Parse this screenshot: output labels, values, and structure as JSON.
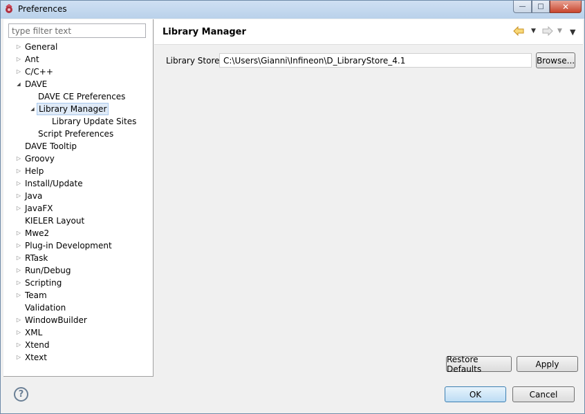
{
  "window": {
    "title": "Preferences",
    "controls": {
      "minimize": "—",
      "maximize": "□",
      "close": "✕"
    }
  },
  "filter": {
    "placeholder": "type filter text",
    "value": ""
  },
  "tree": [
    {
      "label": "General",
      "expander": "collapsed",
      "indent": 0
    },
    {
      "label": "Ant",
      "expander": "collapsed",
      "indent": 0
    },
    {
      "label": "C/C++",
      "expander": "collapsed",
      "indent": 0
    },
    {
      "label": "DAVE",
      "expander": "expanded",
      "indent": 0
    },
    {
      "label": "DAVE CE Preferences",
      "expander": "none",
      "indent": 1
    },
    {
      "label": "Library Manager",
      "expander": "expanded",
      "indent": 1,
      "selected": true
    },
    {
      "label": "Library Update Sites",
      "expander": "none",
      "indent": 2
    },
    {
      "label": "Script Preferences",
      "expander": "none",
      "indent": 1
    },
    {
      "label": "DAVE Tooltip",
      "expander": "none",
      "indent": 0
    },
    {
      "label": "Groovy",
      "expander": "collapsed",
      "indent": 0
    },
    {
      "label": "Help",
      "expander": "collapsed",
      "indent": 0
    },
    {
      "label": "Install/Update",
      "expander": "collapsed",
      "indent": 0
    },
    {
      "label": "Java",
      "expander": "collapsed",
      "indent": 0
    },
    {
      "label": "JavaFX",
      "expander": "collapsed",
      "indent": 0
    },
    {
      "label": "KIELER Layout",
      "expander": "none",
      "indent": 0
    },
    {
      "label": "Mwe2",
      "expander": "collapsed",
      "indent": 0
    },
    {
      "label": "Plug-in Development",
      "expander": "collapsed",
      "indent": 0
    },
    {
      "label": "RTask",
      "expander": "collapsed",
      "indent": 0
    },
    {
      "label": "Run/Debug",
      "expander": "collapsed",
      "indent": 0
    },
    {
      "label": "Scripting",
      "expander": "collapsed",
      "indent": 0
    },
    {
      "label": "Team",
      "expander": "collapsed",
      "indent": 0
    },
    {
      "label": "Validation",
      "expander": "none",
      "indent": 0
    },
    {
      "label": "WindowBuilder",
      "expander": "collapsed",
      "indent": 0
    },
    {
      "label": "XML",
      "expander": "collapsed",
      "indent": 0
    },
    {
      "label": "Xtend",
      "expander": "collapsed",
      "indent": 0
    },
    {
      "label": "Xtext",
      "expander": "collapsed",
      "indent": 0
    }
  ],
  "page": {
    "title": "Library Manager",
    "library_store_label": "Library Store :",
    "library_store_value": "C:\\Users\\Gianni\\Infineon\\D_LibraryStore_4.1",
    "browse_label": "Browse...",
    "restore_defaults_label": "Restore Defaults",
    "apply_label": "Apply"
  },
  "footer": {
    "help_icon": "?",
    "ok_label": "OK",
    "cancel_label": "Cancel"
  },
  "colors": {
    "back_arrow": "#e0a020",
    "forward_arrow": "#b8b8b8",
    "selection_bg": "#dfeaf7"
  }
}
